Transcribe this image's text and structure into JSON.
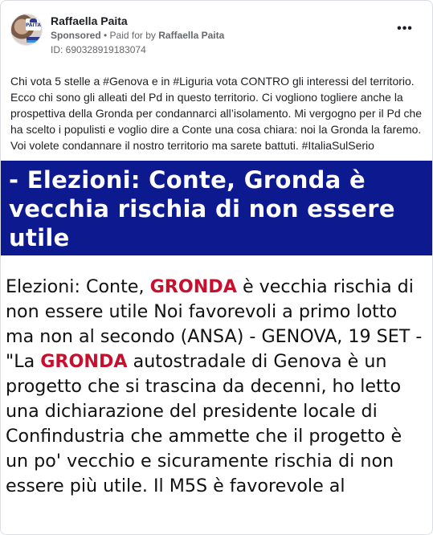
{
  "post": {
    "author": "Raffaella Paita",
    "sponsored_label": "Sponsored",
    "separator": " • ",
    "paid_for_prefix": "Paid for by ",
    "paid_for_name": "Raffaella Paita",
    "ad_id": "ID: 690328919183074",
    "more_icon": "more-options-icon",
    "text": "Chi vota 5 stelle a #Genova e in #Liguria vota CONTRO gli interessi del territorio. Ecco chi sono gli alleati del Pd in questo territorio. Ci vogliono togliere anche la prospettiva della Gronda per condannarci all’isolamento. Mi vergogno per il Pd che ha scelto i populisti e voglio dire a Conte una cosa chiara: noi la Gronda la faremo. Voi volete condannare il nostro territorio ma sarete battuti. #ItaliaSulSerio"
  },
  "avatar": {
    "badge_text": "PAITA"
  },
  "media": {
    "headline": "- Elezioni: Conte, Gronda è vecchia rischia di non essere utile",
    "article": {
      "part1": "Elezioni: Conte, ",
      "highlight1": "GRONDA",
      "part2": " è vecchia rischia di non essere utile Noi favorevoli a primo lotto ma non al secondo (ANSA) - GENOVA, 19 SET - \"La ",
      "highlight2": "GRONDA",
      "part3": " autostradale di Genova è un progetto che si trascina da decenni, ho letto una dichiarazione del presidente locale di Confindustria che ammette che il progetto è un po' vecchio e sicuramente rischia di non essere più utile. Il M5S è favorevole al"
    }
  },
  "colors": {
    "band_bg": "#0d1a8f",
    "highlight": "#c8102e",
    "secondary_text": "#65676b"
  }
}
